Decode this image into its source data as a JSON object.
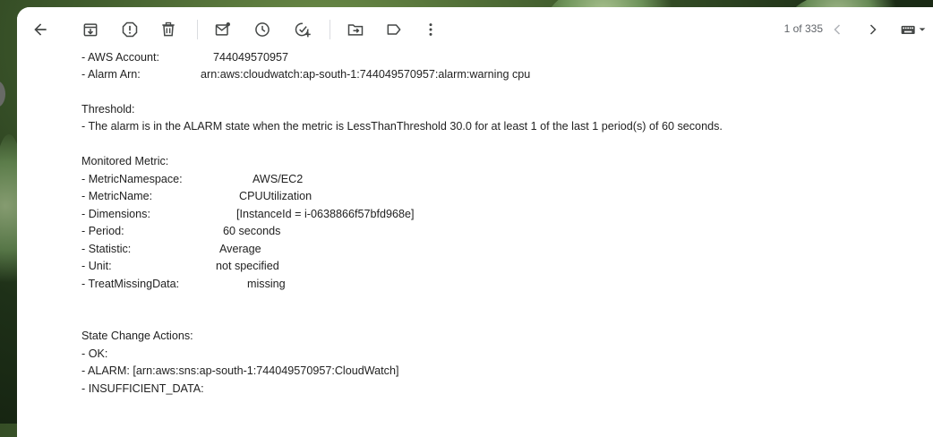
{
  "toolbar": {
    "back_icon": "arrow-back-icon",
    "archive_icon": "archive-icon",
    "spam_icon": "report-spam-icon",
    "delete_icon": "delete-icon",
    "mark_unread_icon": "mark-unread-icon",
    "snooze_icon": "snooze-icon",
    "add_task_icon": "add-task-icon",
    "move_to_icon": "move-to-icon",
    "labels_icon": "label-icon",
    "more_icon": "more-vert-icon",
    "pager_text": "1 of 335",
    "prev_icon": "chevron-left-icon",
    "next_icon": "chevron-right-icon",
    "input_tools_icon": "keyboard-icon"
  },
  "email": {
    "aws_account_label": "- AWS Account:",
    "aws_account_value": "744049570957",
    "alarm_arn_label": "- Alarm Arn:",
    "alarm_arn_value": "arn:aws:cloudwatch:ap-south-1:744049570957:alarm:warning cpu",
    "threshold_heading": "Threshold:",
    "threshold_text": "- The alarm is in the ALARM state when the metric is LessThanThreshold 30.0 for at least 1 of the last 1 period(s) of 60 seconds.",
    "monitored_heading": "Monitored Metric:",
    "metrics": [
      {
        "label": "- MetricNamespace:",
        "value": "AWS/EC2"
      },
      {
        "label": "- MetricName:",
        "value": "CPUUtilization"
      },
      {
        "label": "- Dimensions:",
        "value": "[InstanceId = i-0638866f57bfd968e]"
      },
      {
        "label": "- Period:",
        "value": "60 seconds"
      },
      {
        "label": "- Statistic:",
        "value": "Average"
      },
      {
        "label": "- Unit:",
        "value": "not specified"
      },
      {
        "label": "- TreatMissingData:",
        "value": "missing"
      }
    ],
    "actions_heading": "State Change Actions:",
    "action_ok": "- OK:",
    "action_alarm": "- ALARM: [arn:aws:sns:ap-south-1:744049570957:CloudWatch]",
    "action_insufficient": "- INSUFFICIENT_DATA:"
  }
}
